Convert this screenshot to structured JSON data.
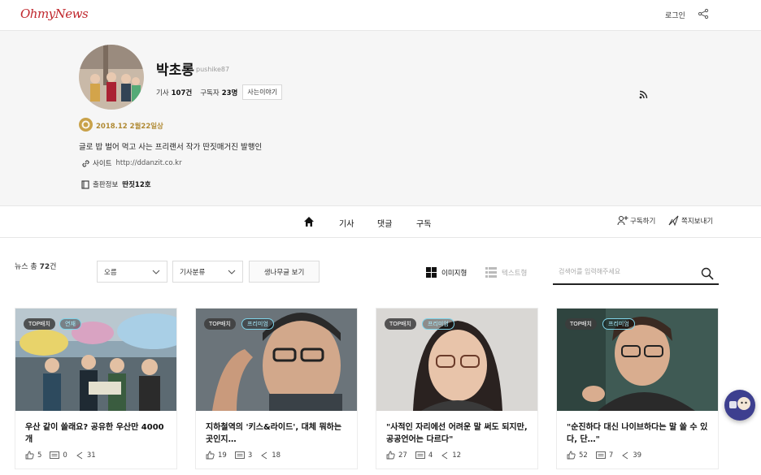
{
  "header": {
    "logo": "OhmyNews",
    "login": "로그인"
  },
  "profile": {
    "name": "박초롱",
    "id": "pushike87",
    "articles_label": "기사",
    "articles_count": "107건",
    "subscribers_label": "구독자",
    "subscribers_count": "23명",
    "life_story": "사는이야기",
    "badge": "2018.12 2월22일상",
    "bio": "글로 밥 벌어 먹고 사는 프리랜서 작가 딴짓매거진 발행인",
    "site_label": "사이트",
    "site_url": "http://ddanzit.co.kr",
    "pub_label": "출판정보",
    "pub_value": "딴짓12호"
  },
  "tabs": {
    "article": "기사",
    "comment": "댓글",
    "subscribe": "구독",
    "subscribe_btn": "구독하기",
    "message_btn": "쪽지보내기"
  },
  "filters": {
    "count_prefix": "뉴스 총",
    "count": "72",
    "count_suffix": "건",
    "sort": "오름",
    "category": "기사분류",
    "grassless": "생나무글 보기",
    "view_image": "이미지형",
    "view_text": "텍스트형",
    "search_placeholder": "검색어를 입력해주세요"
  },
  "cards": [
    {
      "tag1": "TOP배치",
      "tag2": "연재",
      "title": "우산 같이 쓸래요? 공유한 우산만 4000개",
      "likes": "5",
      "comments": "0",
      "shares": "31"
    },
    {
      "tag1": "TOP배치",
      "tag2": "프리미엄",
      "title": "지하철역의 '키스&라이드', 대체 뭐하는 곳인지…",
      "likes": "19",
      "comments": "3",
      "shares": "18"
    },
    {
      "tag1": "TOP배치",
      "tag2": "프리미엄",
      "title": "\"사적인 자리에선 어려운 말 써도 되지만, 공공언어는 다르다\"",
      "likes": "27",
      "comments": "4",
      "shares": "12"
    },
    {
      "tag1": "TOP배치",
      "tag2": "프리미엄",
      "title": "\"순진하다 대신 나이브하다는 말 쓸 수 있다, 단…\"",
      "likes": "52",
      "comments": "7",
      "shares": "39"
    }
  ],
  "colors": {
    "brand": "#c0272d",
    "badge": "#c9a24a",
    "chat": "#3d3f8f"
  }
}
